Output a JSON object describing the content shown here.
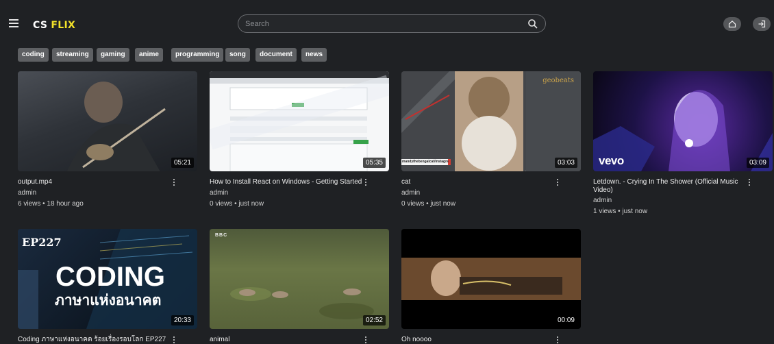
{
  "brand": {
    "part1": "CS",
    "part2": "FLIX"
  },
  "header": {
    "search_placeholder": "Search"
  },
  "icons": {
    "menu": "menu-icon",
    "search": "search-icon",
    "home": "home-icon",
    "login": "login-icon"
  },
  "colors": {
    "background": "#1f2124",
    "brand_accent": "#f3e22a",
    "chip_bg": "#5e6063"
  },
  "categories": [
    "coding",
    "streaming",
    "gaming",
    "anime",
    "programming",
    "song",
    "document",
    "news"
  ],
  "videos": [
    {
      "title": "output.mp4",
      "channel": "admin",
      "meta": "6 views • 18 hour ago",
      "duration": "05:21"
    },
    {
      "title": "How to Install React on Windows - Getting Started",
      "channel": "admin",
      "meta": "0 views • just now",
      "duration": "05:35"
    },
    {
      "title": "cat",
      "channel": "admin",
      "meta": "0 views • just now",
      "duration": "03:03",
      "thumb_text": "geobeats",
      "thumb_caption": "mandythebengalcat/Instagram"
    },
    {
      "title": "Letdown. - Crying In The Shower (Official Music Video)",
      "channel": "admin",
      "meta": "1 views • just now",
      "duration": "03:09",
      "thumb_text": "vevo"
    },
    {
      "title": "Coding ภาษาแห่งอนาคต ร้อยเรื่องรอบโลก EP227",
      "channel": "",
      "meta": "",
      "duration": "20:33",
      "thumb_ep": "EP227",
      "thumb_big": "CODING",
      "thumb_sub": "ภาษาแห่งอนาคต"
    },
    {
      "title": "animal",
      "channel": "",
      "meta": "",
      "duration": "02:52",
      "thumb_text": "BBC"
    },
    {
      "title": "Oh noooo",
      "channel": "",
      "meta": "",
      "duration": "00:09"
    }
  ]
}
